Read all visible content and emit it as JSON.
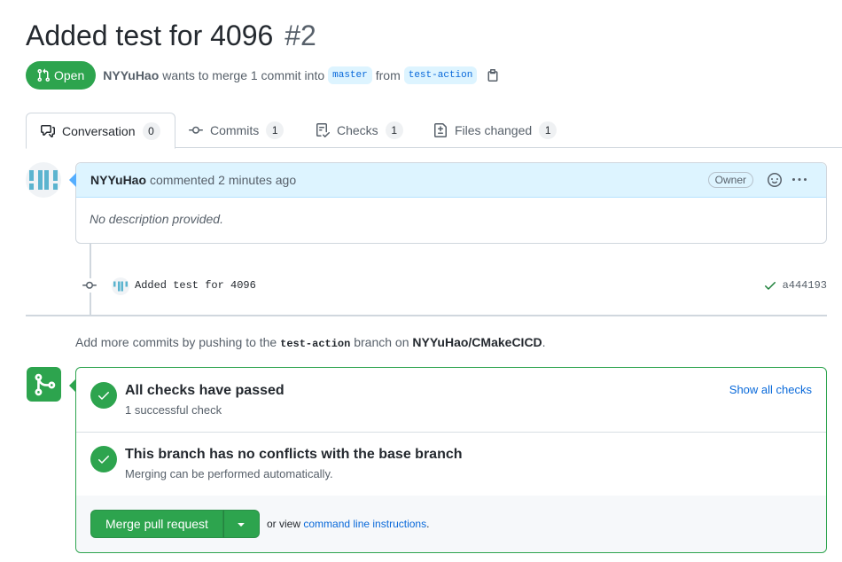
{
  "header": {
    "title": "Added test for 4096",
    "number": "#2"
  },
  "meta": {
    "state": "Open",
    "author": "NYYuHao",
    "text": "wants to merge 1 commit into",
    "base_branch": "master",
    "from_word": "from",
    "head_branch": "test-action"
  },
  "tabs": [
    {
      "label": "Conversation",
      "count": "0",
      "icon": "comment-discussion-icon"
    },
    {
      "label": "Commits",
      "count": "1",
      "icon": "git-commit-icon"
    },
    {
      "label": "Checks",
      "count": "1",
      "icon": "checklist-icon"
    },
    {
      "label": "Files changed",
      "count": "1",
      "icon": "file-diff-icon"
    }
  ],
  "comment": {
    "author": "NYYuHao",
    "action": "commented",
    "time": "2 minutes ago",
    "badge": "Owner",
    "body": "No description provided."
  },
  "commit": {
    "message": "Added test for 4096",
    "sha": "a444193"
  },
  "hint": {
    "prefix": "Add more commits by pushing to the",
    "branch": "test-action",
    "middle": "branch on",
    "repo": "NYYuHao/CMakeCICD",
    "suffix": "."
  },
  "merge": {
    "checks_title": "All checks have passed",
    "checks_sub": "1 successful check",
    "show_checks": "Show all checks",
    "conflicts_title": "This branch has no conflicts with the base branch",
    "conflicts_sub": "Merging can be performed automatically.",
    "button": "Merge pull request",
    "or_view": "or view",
    "cli_link": "command line instructions",
    "cli_suffix": "."
  },
  "colors": {
    "green": "#2da44e",
    "blue": "#0969da",
    "muted": "#57606a"
  }
}
